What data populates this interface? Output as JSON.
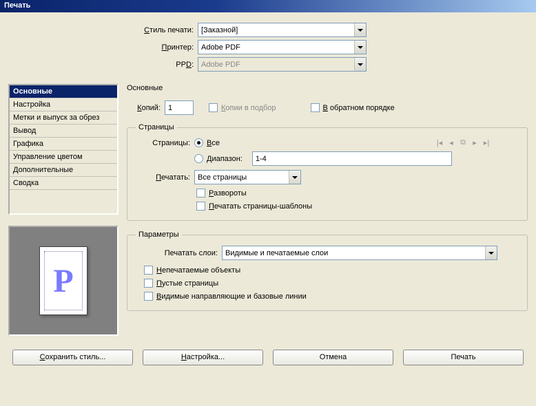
{
  "window": {
    "title": "Печать"
  },
  "labels": {
    "print_style": "Стиль печати:",
    "printer": "Принтер:",
    "ppd": "PPD:",
    "copies": "Копий:",
    "collate": "Копии в подбор",
    "reverse": "В обратном порядке",
    "pages_group": "Страницы",
    "pages_label": "Страницы:",
    "all": "Все",
    "range": "Диапазон:",
    "print_label": "Печатать:",
    "spreads": "Развороты",
    "master_pages": "Печатать страницы-шаблоны",
    "options_group": "Параметры",
    "layers_label": "Печатать слои:",
    "nonprint": "Непечатаемые объекты",
    "blank": "Пустые страницы",
    "guides": "Видимые направляющие и базовые линии"
  },
  "values": {
    "print_style": "[Заказной]",
    "printer": "Adobe PDF",
    "ppd": "Adobe PDF",
    "copies": "1",
    "range": "1-4",
    "print_pages": "Все страницы",
    "layers": "Видимые и печатаемые слои"
  },
  "sidebar": {
    "items": [
      "Основные",
      "Настройка",
      "Метки и выпуск за обрез",
      "Вывод",
      "Графика",
      "Управление цветом",
      "Дополнительные",
      "Сводка"
    ],
    "active_index": 0
  },
  "section_title": "Основные",
  "buttons": {
    "save_style": "Сохранить стиль...",
    "setup": "Настройка...",
    "cancel": "Отмена",
    "print": "Печать"
  },
  "preview_letter": "P"
}
